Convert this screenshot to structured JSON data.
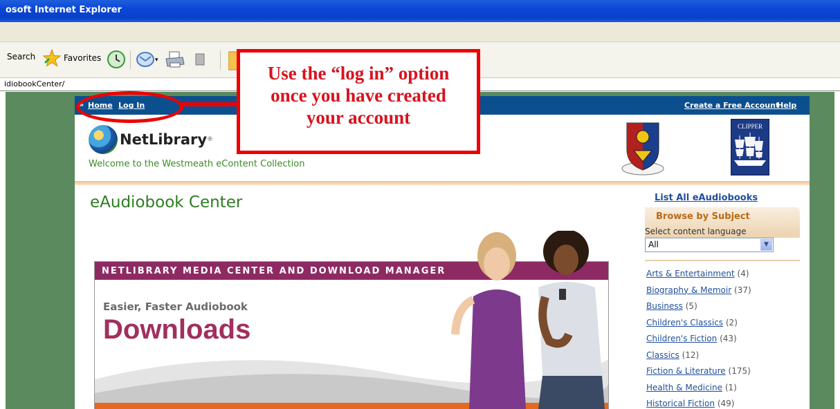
{
  "browser": {
    "title": "osoft Internet Explorer",
    "toolbar": {
      "search_label": "Search",
      "favorites_label": "Favorites"
    },
    "address": "idiobookCenter/"
  },
  "site": {
    "nav": {
      "home": "Home",
      "login": "Log In",
      "create_account": "Create a Free Account",
      "help": "Help"
    },
    "logo_text": "NetLibrary",
    "welcome": "Welcome to the Westmeath eContent Collection",
    "clipper_label": "CLIPPER",
    "page_title": "eAudiobook Center"
  },
  "banner": {
    "header": "NETLIBRARY MEDIA CENTER AND DOWNLOAD MANAGER",
    "subtitle": "Easier, Faster Audiobook",
    "headline": "Downloads"
  },
  "sidebar": {
    "list_all": "List All eAudiobooks",
    "browse_title": "Browse by Subject",
    "language_label": "Select content language",
    "language_value": "All",
    "subjects": [
      {
        "name": "Arts & Entertainment",
        "count": "(4)"
      },
      {
        "name": "Biography & Memoir",
        "count": "(37)"
      },
      {
        "name": "Business",
        "count": "(5)"
      },
      {
        "name": "Children's Classics",
        "count": "(2)"
      },
      {
        "name": "Children's Fiction",
        "count": "(43)"
      },
      {
        "name": "Classics",
        "count": "(12)"
      },
      {
        "name": "Fiction & Literature",
        "count": "(175)"
      },
      {
        "name": "Health & Medicine",
        "count": "(1)"
      },
      {
        "name": "Historical Fiction",
        "count": "(49)"
      }
    ]
  },
  "annotation": {
    "line1": "Use the “log in” option",
    "line2": "once you have created",
    "line3": "your account"
  },
  "colors": {
    "nav_blue": "#0c4f8f",
    "accent_green": "#2e7d22",
    "callout_red": "#ee0000",
    "banner_magenta": "#8e2a63"
  }
}
